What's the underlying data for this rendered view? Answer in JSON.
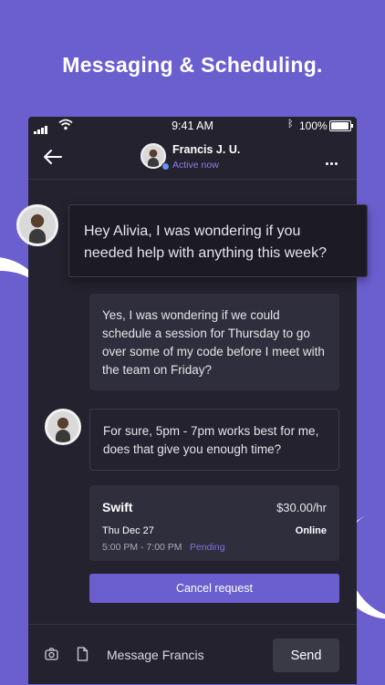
{
  "headline": "Messaging & Scheduling.",
  "statusbar": {
    "time": "9:41 AM",
    "battery": "100%"
  },
  "header": {
    "contact_name": "Francis J. U.",
    "contact_status": "Active now"
  },
  "messages": [
    {
      "from": "Francis",
      "text": "Hey Alivia, I was wondering if you needed help with anything this week?"
    },
    {
      "from": "me",
      "text": "Yes, I was wondering if we could schedule a session for Thursday to go over some of my code before I meet with the team on Friday?"
    },
    {
      "from": "Francis",
      "text": "For sure, 5pm - 7pm works best for me, does that give you enough time?"
    }
  ],
  "booking": {
    "subject": "Swift",
    "price": "$30.00/hr",
    "date": "Thu Dec 27",
    "mode": "Online",
    "hours": "5:00 PM - 7:00 PM",
    "status": "Pending",
    "cancel_label": "Cancel request"
  },
  "composer": {
    "placeholder": "Message Francis",
    "send_label": "Send"
  },
  "colors": {
    "accent": "#6b5fd0",
    "background": "#23222e",
    "bubble": "#2f2e3c"
  }
}
